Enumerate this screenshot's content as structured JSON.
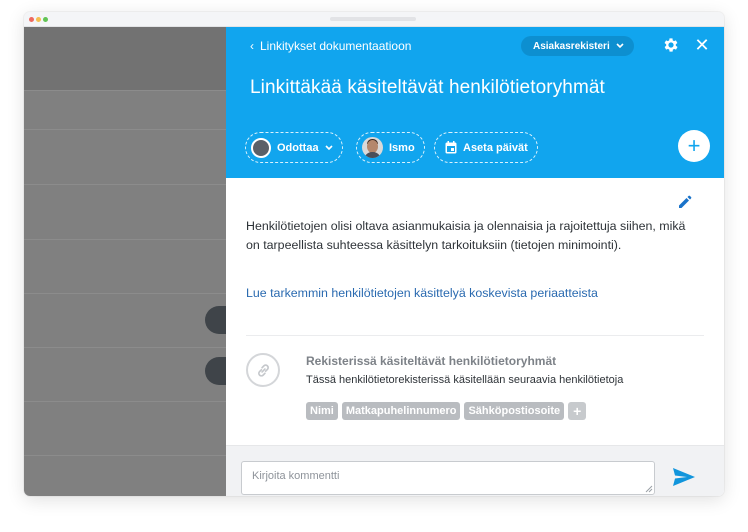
{
  "panel": {
    "back_label": "Linkitykset dokumentaatioon",
    "register_label": "Asiakasrekisteri",
    "title": "Linkittäkää käsiteltävät henkilötietoryhmät",
    "status_label": "Odottaa",
    "assignee_label": "Ismo",
    "date_label": "Aseta päivät",
    "description": "Henkilötietojen olisi oltava asianmukaisia ja olennaisia ja rajoitettuja siihen, mikä on tarpeellista suhteessa käsittelyn tarkoituksiin (tietojen minimointi).",
    "read_more_link": "Lue tarkemmin henkilötietojen käsittelyä koskevista periaatteista",
    "section": {
      "title": "Rekisterissä käsiteltävät henkilötietoryhmät",
      "subtitle": "Tässä henkilötietorekisterissä käsitellään seuraavia henkilötietoja",
      "tags": [
        "Nimi",
        "Matkapuhelinnumero",
        "Sähköpostiosoite"
      ]
    },
    "comment_placeholder": "Kirjoita kommentti"
  },
  "colors": {
    "header": "#11a5ee",
    "pill": "#0d8fd0",
    "link": "#2a6ab0",
    "tag": "#b9bcc0"
  },
  "icons": [
    "chevron-left-icon",
    "chevron-down-icon",
    "gear-icon",
    "close-icon",
    "calendar-icon",
    "plus-icon",
    "pencil-icon",
    "link-icon",
    "send-icon"
  ]
}
